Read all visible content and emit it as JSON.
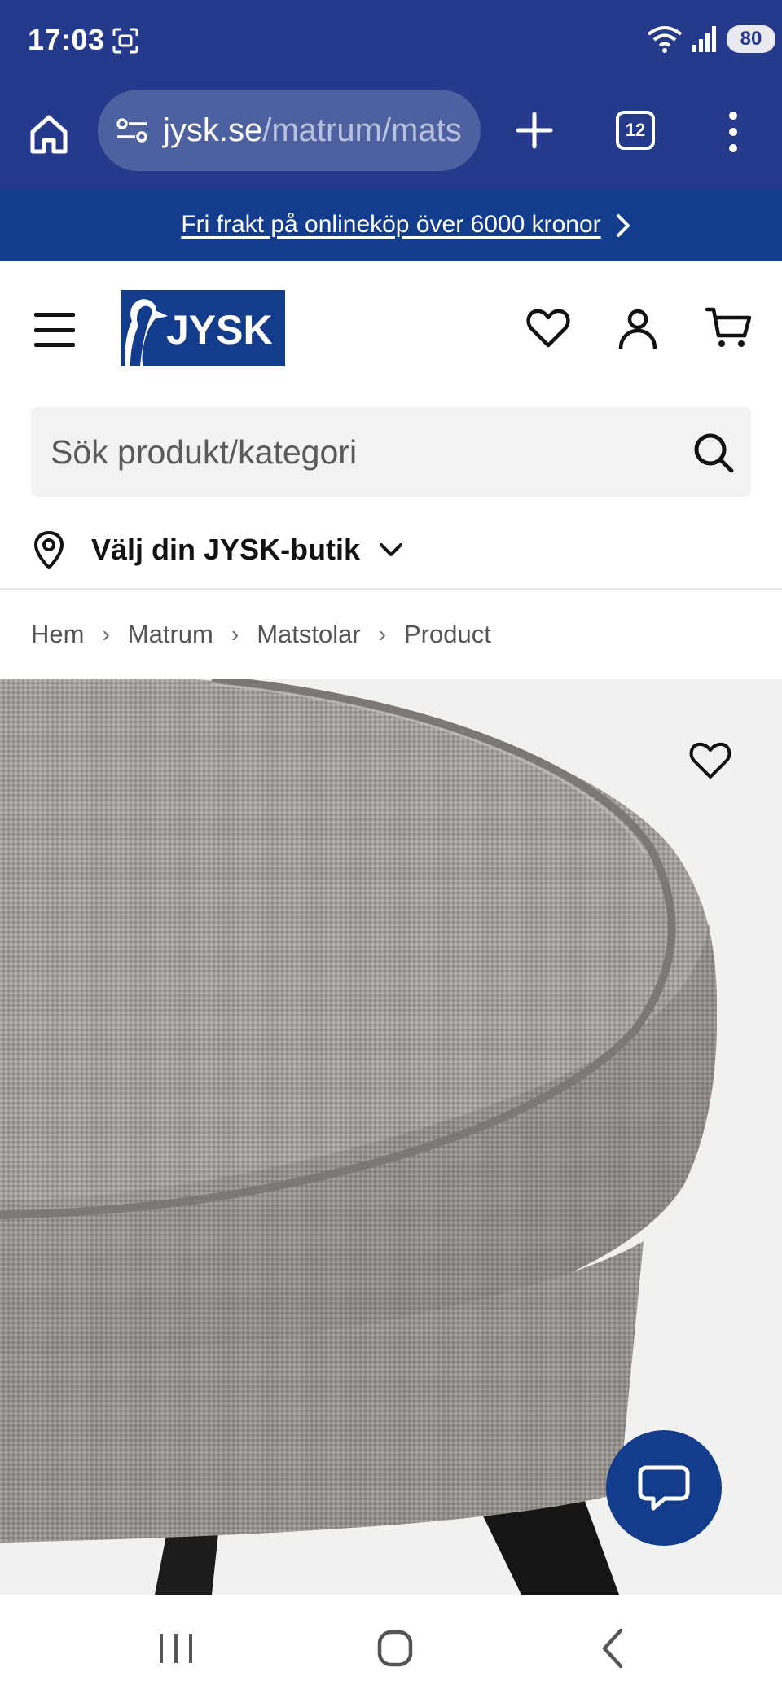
{
  "status_bar": {
    "time": "17:03",
    "battery": "80",
    "icons": [
      "screenshot-icon",
      "wifi-icon",
      "signal-icon",
      "battery-icon"
    ]
  },
  "browser": {
    "url_domain": "jysk.se",
    "url_path": "/matrum/mats",
    "tab_count": "12",
    "icons": [
      "home-icon",
      "site-settings-icon",
      "plus-icon",
      "tabs-icon",
      "more-icon"
    ]
  },
  "promo": {
    "text": "Fri frakt på onlineköp över 6000 kronor"
  },
  "header": {
    "logo_text": "JYSK",
    "icons": [
      "menu-icon",
      "heart-icon",
      "user-icon",
      "cart-icon"
    ]
  },
  "search": {
    "placeholder": "Sök produkt/kategori"
  },
  "store": {
    "label": "Välj din JYSK-butik"
  },
  "breadcrumb": {
    "items": [
      "Hem",
      "Matrum",
      "Matstolar",
      "Product"
    ]
  },
  "colors": {
    "browser_blue": "#253a8a",
    "brand_blue": "#143c8c",
    "search_bg": "#f2f2f2"
  }
}
